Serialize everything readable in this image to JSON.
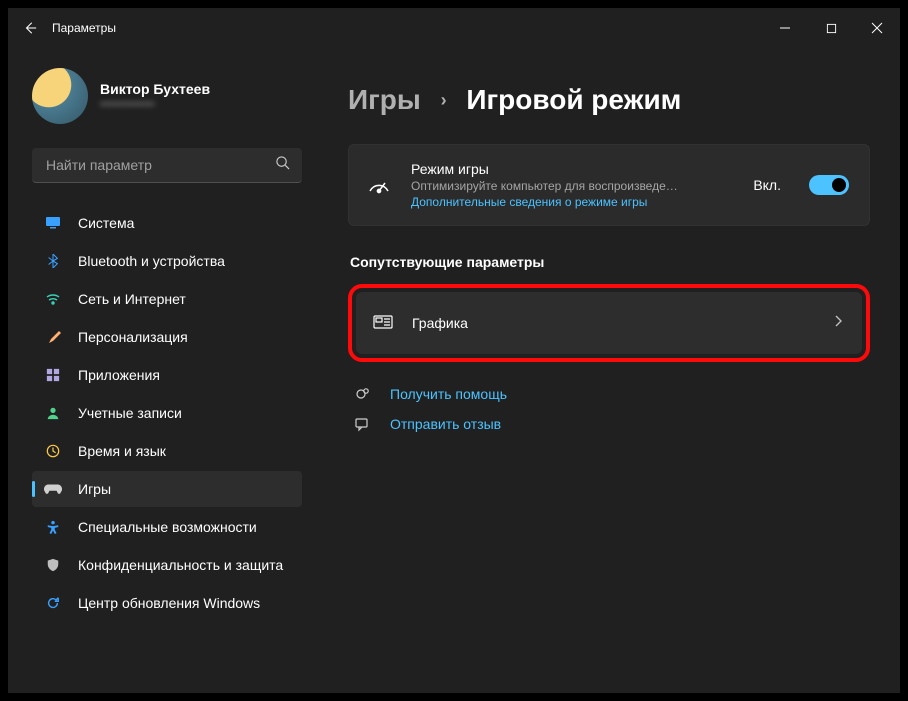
{
  "app_title": "Параметры",
  "user": {
    "name": "Виктор Бухтеев",
    "email_masked": "•••••••••••••"
  },
  "search": {
    "placeholder": "Найти параметр"
  },
  "nav": [
    {
      "id": "system",
      "label": "Система",
      "icon": "monitor",
      "color": "#3aa0ff"
    },
    {
      "id": "bluetooth",
      "label": "Bluetooth и устройства",
      "icon": "bluetooth",
      "color": "#3aa0ff"
    },
    {
      "id": "network",
      "label": "Сеть и Интернет",
      "icon": "wifi",
      "color": "#3ad1b8"
    },
    {
      "id": "personalization",
      "label": "Персонализация",
      "icon": "brush",
      "color": "#ffb072"
    },
    {
      "id": "apps",
      "label": "Приложения",
      "icon": "apps",
      "color": "#b0a8e0"
    },
    {
      "id": "accounts",
      "label": "Учетные записи",
      "icon": "person",
      "color": "#4fd38a"
    },
    {
      "id": "time",
      "label": "Время и язык",
      "icon": "clock",
      "color": "#ffc94a"
    },
    {
      "id": "games",
      "label": "Игры",
      "icon": "gamepad",
      "color": "#d0d0d0",
      "active": true
    },
    {
      "id": "accessibility",
      "label": "Специальные возможности",
      "icon": "accessibility",
      "color": "#3aa0ff"
    },
    {
      "id": "privacy",
      "label": "Конфиденциальность и защита",
      "icon": "shield",
      "color": "#bfbfbf"
    },
    {
      "id": "update",
      "label": "Центр обновления Windows",
      "icon": "update",
      "color": "#3aa0ff"
    }
  ],
  "breadcrumb": {
    "parent": "Игры",
    "current": "Игровой режим"
  },
  "game_mode_card": {
    "title": "Режим игры",
    "subtitle": "Оптимизируйте компьютер для воспроизведе…",
    "link": "Дополнительные сведения о режиме игры",
    "state_label": "Вкл.",
    "on": true
  },
  "related_section_label": "Сопутствующие параметры",
  "graphics_row": {
    "label": "Графика"
  },
  "help_links": {
    "help": "Получить помощь",
    "feedback": "Отправить отзыв"
  }
}
